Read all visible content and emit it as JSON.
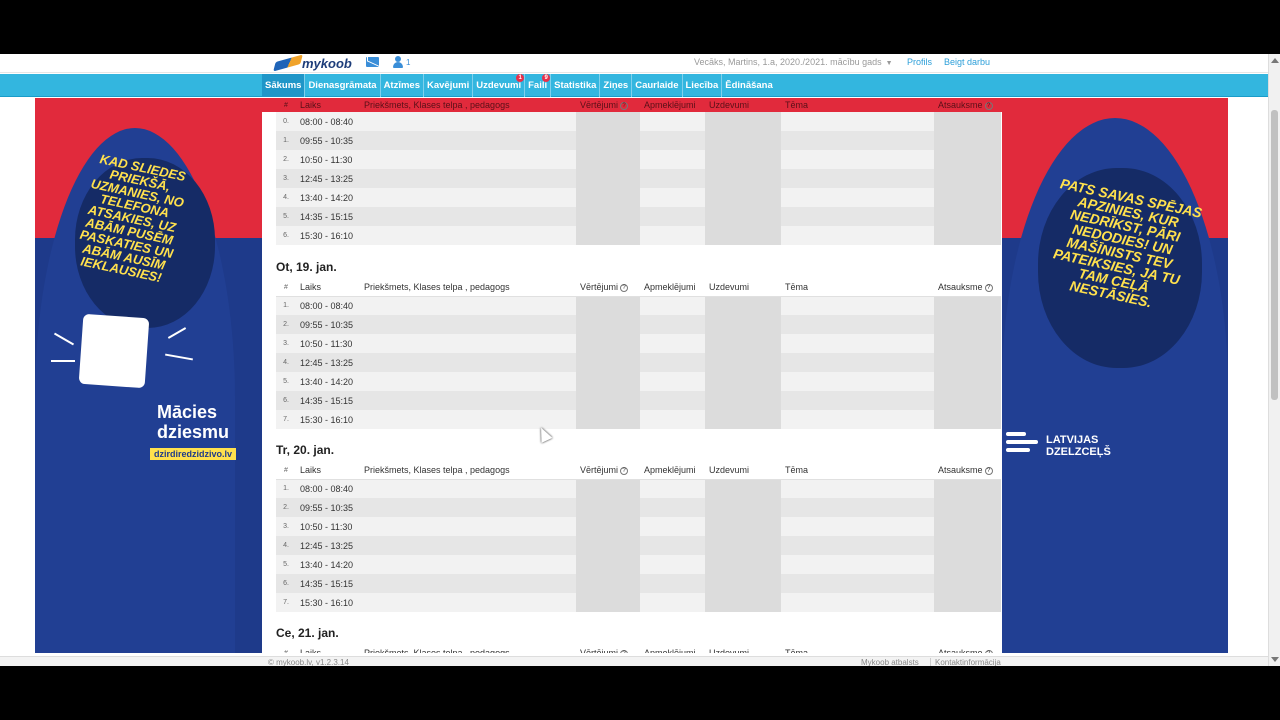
{
  "header": {
    "logo_text": "mykoob",
    "messages_icon": "mail-icon",
    "users_icon": "users-icon",
    "users_count": "1",
    "user_info": "Vecāks, Martins, 1.a, 2020./2021. mācību gads",
    "profile_link": "Profils",
    "logout_link": "Beigt darbu"
  },
  "nav": {
    "items": [
      {
        "label": "Sākums",
        "active": true
      },
      {
        "label": "Dienasgrāmata"
      },
      {
        "label": "Atzīmes"
      },
      {
        "label": "Kavējumi"
      },
      {
        "label": "Uzdevumi",
        "badge": "1"
      },
      {
        "label": "Faili",
        "badge": "9"
      },
      {
        "label": "Statistika"
      },
      {
        "label": "Ziņes"
      },
      {
        "label": "Caurlaide"
      },
      {
        "label": "Liecība"
      },
      {
        "label": "Ēdināšana"
      }
    ]
  },
  "columns": {
    "num": "#",
    "time": "Laiks",
    "subject": "Priekšmets, Klases telpa , pedagogs",
    "grades": "Vērtējumi",
    "attendance": "Apmeklējumi",
    "tasks": "Uzdevumi",
    "topic": "Tēma",
    "feedback": "Atsauksme"
  },
  "days": [
    {
      "title": "",
      "lessons": [
        {
          "num": "0.",
          "time": "08:00 - 08:40"
        },
        {
          "num": "1.",
          "time": "09:55 - 10:35"
        },
        {
          "num": "2.",
          "time": "10:50 - 11:30"
        },
        {
          "num": "3.",
          "time": "12:45 - 13:25"
        },
        {
          "num": "4.",
          "time": "13:40 - 14:20"
        },
        {
          "num": "5.",
          "time": "14:35 - 15:15"
        },
        {
          "num": "6.",
          "time": "15:30 - 16:10"
        }
      ]
    },
    {
      "title": "Ot, 19. jan.",
      "lessons": [
        {
          "num": "1.",
          "time": "08:00 - 08:40"
        },
        {
          "num": "2.",
          "time": "09:55 - 10:35"
        },
        {
          "num": "3.",
          "time": "10:50 - 11:30"
        },
        {
          "num": "4.",
          "time": "12:45 - 13:25"
        },
        {
          "num": "5.",
          "time": "13:40 - 14:20"
        },
        {
          "num": "6.",
          "time": "14:35 - 15:15"
        },
        {
          "num": "7.",
          "time": "15:30 - 16:10"
        }
      ]
    },
    {
      "title": "Tr, 20. jan.",
      "lessons": [
        {
          "num": "1.",
          "time": "08:00 - 08:40"
        },
        {
          "num": "2.",
          "time": "09:55 - 10:35"
        },
        {
          "num": "3.",
          "time": "10:50 - 11:30"
        },
        {
          "num": "4.",
          "time": "12:45 - 13:25"
        },
        {
          "num": "5.",
          "time": "13:40 - 14:20"
        },
        {
          "num": "6.",
          "time": "14:35 - 15:15"
        },
        {
          "num": "7.",
          "time": "15:30 - 16:10"
        }
      ]
    },
    {
      "title": "Ce, 21. jan.",
      "lessons": []
    }
  ],
  "ads": {
    "left": {
      "slogan": "KAD SLIEDES PRIEKŠĀ, UZMANIES, NO TELEFONA ATSAKIES, UZ ABĀM PUSĒM PASKATIES UN ABĀM AUSĪM IEKLAUSIES!",
      "headline_line1": "Mācies",
      "headline_line2": "dziesmu",
      "url": "dzirdiredzidzivo.lv"
    },
    "right": {
      "slogan": "PATS SAVAS SPĒJAS APZINIES, KUR NEDRĪKST, PĀRI NEDODIES! UN MAŠĪNISTS TEV PATEIKSIES, JA TU TAM CEĻĀ NESTĀSIES.",
      "brand_line1": "LATVIJAS",
      "brand_line2": "DZELZCEĻŠ"
    }
  },
  "footer": {
    "copyright": "©  mykoob.lv, v1.2.3.14",
    "support": "Mykoob atbalsts",
    "contact": "Kontaktinformācija"
  },
  "colors": {
    "nav_bg": "#33b6df",
    "ad_red": "#e12a3c",
    "ad_blue": "#1e3a8a",
    "ad_yellow": "#ffe14d",
    "link": "#2d9fd9"
  }
}
